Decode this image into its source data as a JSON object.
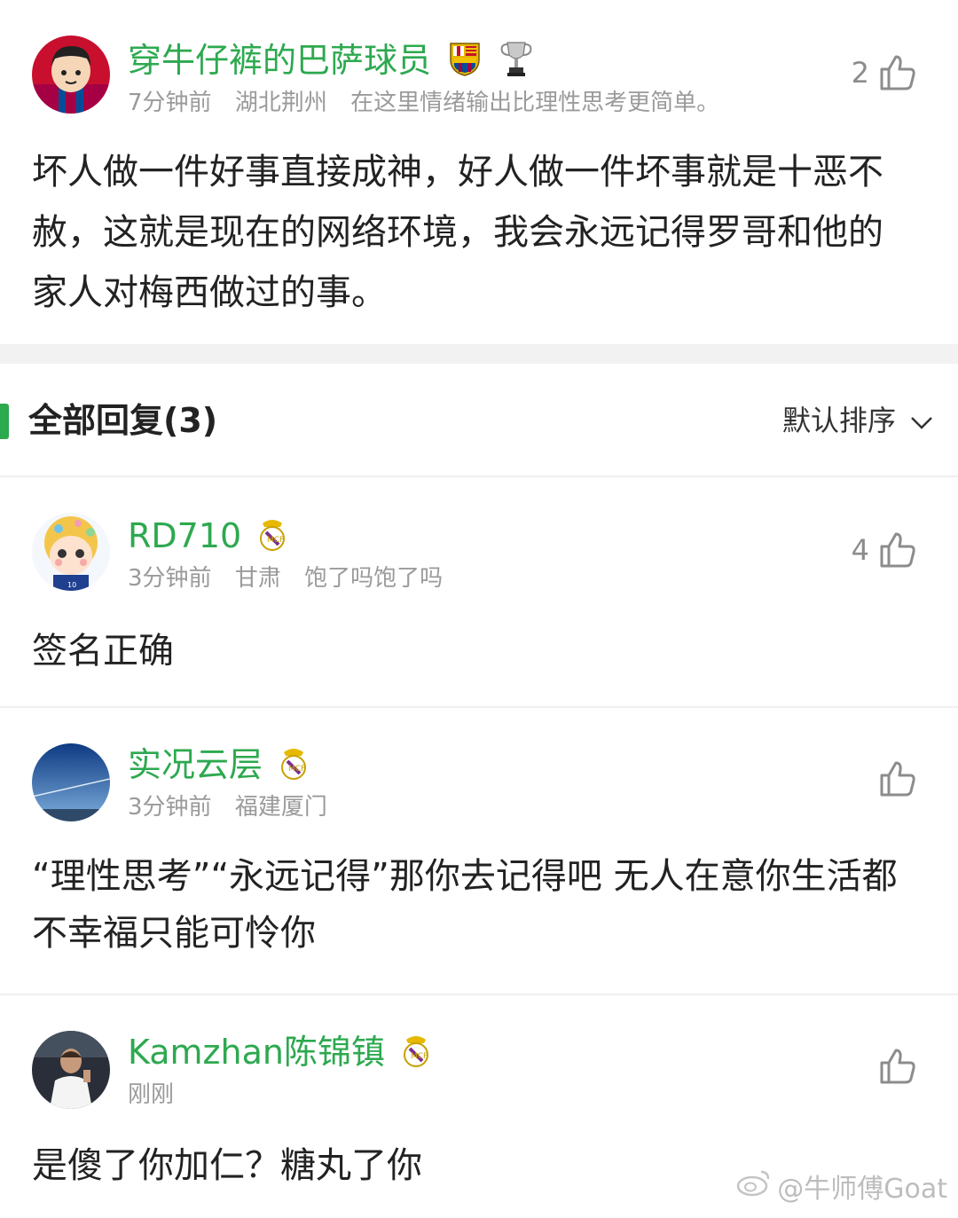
{
  "main_comment": {
    "username": "穿牛仔裤的巴萨球员",
    "time": "7分钟前",
    "location": "湖北荆州",
    "signature": "在这里情绪输出比理性思考更简单。",
    "likes": "2",
    "text": "坏人做一件好事直接成神，好人做一件坏事就是十恶不赦，这就是现在的网络环境，我会永远记得罗哥和他的家人对梅西做过的事。"
  },
  "replies_header": {
    "title": "全部回复(3)",
    "sort_label": "默认排序"
  },
  "replies": [
    {
      "username": "RD710",
      "time": "3分钟前",
      "location": "甘肃",
      "signature": "饱了吗饱了吗",
      "likes": "4",
      "text": "签名正确"
    },
    {
      "username": "实况云层",
      "time": "3分钟前",
      "location": "福建厦门",
      "likes": "",
      "text": "“理性思考”“永远记得”那你去记得吧 无人在意你生活都不幸福只能可怜你"
    },
    {
      "username": "Kamzhan陈锦镇",
      "time": "刚刚",
      "likes": "",
      "text": "是傻了你加仁？糖丸了你"
    }
  ],
  "watermark": "@牛师傅Goat",
  "colors": {
    "username": "#2da94f",
    "meta": "#9a9a9a",
    "accent_bar": "#2da94f",
    "divider": "#f2f2f2"
  }
}
